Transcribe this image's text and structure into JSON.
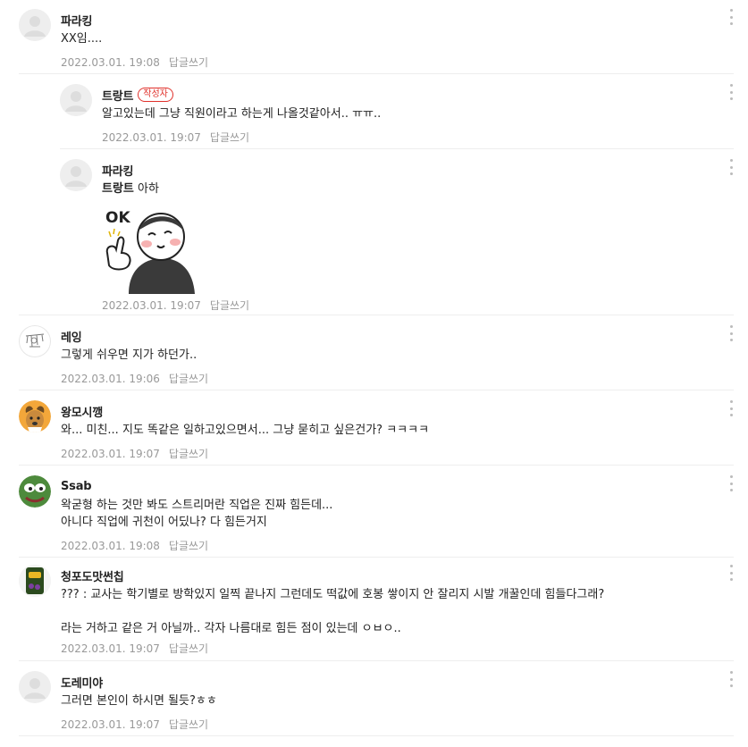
{
  "reply_label": "답글쓰기",
  "author_badge": "작성자",
  "colors": {
    "badge": "#e0312b",
    "meta": "#999999",
    "divider": "#eeeeee"
  },
  "comments": [
    {
      "nick": "파라킹",
      "text": "XX임....",
      "time": "2022.03.01. 19:08",
      "avatar": "default-avatar"
    },
    {
      "nick": "트랑트",
      "badge": true,
      "text": "알고있는데 그냥 직원이라고 하는게 나올것같아서.. ㅠㅠ..",
      "time": "2022.03.01. 19:07",
      "avatar": "default-avatar",
      "reply": true
    },
    {
      "nick": "파라킹",
      "mention": "트랑트",
      "text": "아하",
      "sticker": "ok-sticker",
      "sticker_text": "OK",
      "time": "2022.03.01. 19:07",
      "avatar": "default-avatar",
      "reply": true
    },
    {
      "nick": "레잉",
      "text": "그렇게 쉬우면 지가 하던가..",
      "time": "2022.03.01. 19:06",
      "avatar": "sketch-avatar"
    },
    {
      "nick": "왕모시깽",
      "text": "와... 미친... 지도 똑같은 일하고있으면서... 그냥 묻히고 싶은건가? ㅋㅋㅋㅋ",
      "time": "2022.03.01. 19:07",
      "avatar": "dog-avatar"
    },
    {
      "nick": "Ssab",
      "text": "왁굳형 하는 것만 봐도 스트리머란 직업은 진짜 힘든데...\n아니다 직업에 귀천이 어딨나? 다 힘든거지",
      "time": "2022.03.01. 19:08",
      "avatar": "frog-avatar"
    },
    {
      "nick": "청포도맛썬칩",
      "text": "??? : 교사는 학기별로 방학있지 일찍 끝나지 그런데도 떡값에 호봉 쌓이지 안 잘리지 시발 개꿀인데 힘들다그래?\n\n라는 거하고 같은 거 아닐까.. 각자 나름대로 힘든 점이 있는데 ㅇㅂㅇ..",
      "time": "2022.03.01. 19:07",
      "avatar": "snack-avatar"
    },
    {
      "nick": "도레미야",
      "text": "그러면 본인이 하시면 될듯?ㅎㅎ",
      "time": "2022.03.01. 19:07",
      "avatar": "default-avatar"
    }
  ]
}
